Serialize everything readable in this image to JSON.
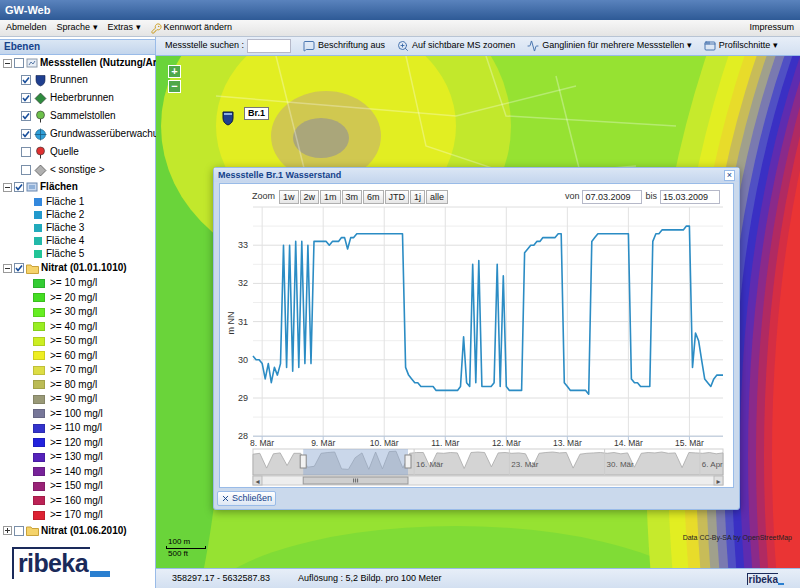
{
  "window": {
    "title": "GW-Web"
  },
  "menu": {
    "items": [
      {
        "label": "Abmelden"
      },
      {
        "label": "Sprache ▾"
      },
      {
        "label": "Extras ▾"
      },
      {
        "label": "Kennwort ändern"
      }
    ],
    "right": "Impressum"
  },
  "sidebar": {
    "title": "Ebenen",
    "groups": [
      {
        "label": "Messstellen (Nutzung/Art)",
        "kind": "stations",
        "checked": false,
        "expanded": true,
        "items": [
          {
            "label": "Brunnen",
            "checked": true,
            "color": "#1f3f8f"
          },
          {
            "label": "Heberbrunnen",
            "checked": true,
            "color": "#2e8b3e"
          },
          {
            "label": "Sammelstollen",
            "checked": true,
            "color": "#6cc04a"
          },
          {
            "label": "Grundwasserüberwachung",
            "checked": true,
            "color": "#2f9fd8"
          },
          {
            "label": "Quelle",
            "checked": false,
            "color": "#e03030"
          },
          {
            "label": "< sonstige >",
            "checked": false,
            "color": "#b0b0b0"
          }
        ]
      },
      {
        "label": "Flächen",
        "kind": "areas",
        "checked": true,
        "expanded": true,
        "items": [
          {
            "label": "Fläche 1",
            "color": "#3388dd"
          },
          {
            "label": "Fläche 2",
            "color": "#2299cc"
          },
          {
            "label": "Fläche 3",
            "color": "#22aabb"
          },
          {
            "label": "Fläche 4",
            "color": "#22b8a8"
          },
          {
            "label": "Fläche 5",
            "color": "#22c496"
          }
        ]
      },
      {
        "label": "Nitrat (01.01.1010)",
        "kind": "legend",
        "checked": true,
        "expanded": true,
        "items": [
          {
            "label": ">= 10 mg/l",
            "color": "#33cc33"
          },
          {
            "label": ">= 20 mg/l",
            "color": "#44dd22"
          },
          {
            "label": ">= 30 mg/l",
            "color": "#66ee22"
          },
          {
            "label": ">= 40 mg/l",
            "color": "#99ee22"
          },
          {
            "label": ">= 50 mg/l",
            "color": "#ccee22"
          },
          {
            "label": ">= 60 mg/l",
            "color": "#eeee22"
          },
          {
            "label": ">= 70 mg/l",
            "color": "#dddd44"
          },
          {
            "label": ">= 80 mg/l",
            "color": "#bbbb55"
          },
          {
            "label": ">= 90 mg/l",
            "color": "#999977"
          },
          {
            "label": ">= 100 mg/l",
            "color": "#777799"
          },
          {
            "label": ">= 110 mg/l",
            "color": "#3333cc"
          },
          {
            "label": ">= 120 mg/l",
            "color": "#2222dd"
          },
          {
            "label": ">= 130 mg/l",
            "color": "#5522bb"
          },
          {
            "label": ">= 140 mg/l",
            "color": "#772299"
          },
          {
            "label": ">= 150 mg/l",
            "color": "#992277"
          },
          {
            "label": ">= 160 mg/l",
            "color": "#bb2255"
          },
          {
            "label": ">= 170 mg/l",
            "color": "#dd2233"
          }
        ]
      },
      {
        "label": "Nitrat (01.06.2010)",
        "kind": "legend",
        "checked": false,
        "expanded": false,
        "items": []
      }
    ]
  },
  "logo": {
    "text": "ribeka"
  },
  "toolbar": {
    "search_label": "Messstelle suchen :",
    "search_value": "",
    "buttons": [
      "Beschriftung aus",
      "Auf sichtbare MS zoomen",
      "Ganglinien für mehrere Messstellen ▾",
      "Profilschnitte ▾"
    ]
  },
  "map": {
    "zoom_in": "+",
    "zoom_out": "−",
    "markers": [
      {
        "label": "Br.1"
      }
    ],
    "scale": {
      "metric": "100 m",
      "imperial": "500 ft"
    },
    "attribution": "Data CC-By-SA by OpenStreetMap"
  },
  "dialog": {
    "title": "Messstelle Br.1 Wasserstand",
    "close": "×",
    "zoom_label": "Zoom",
    "zoom_buttons": [
      {
        "label": "1w",
        "selected": false
      },
      {
        "label": "2w",
        "selected": false
      },
      {
        "label": "1m",
        "selected": false
      },
      {
        "label": "3m",
        "selected": false
      },
      {
        "label": "6m",
        "selected": false
      },
      {
        "label": "JTD",
        "selected": false
      },
      {
        "label": "1j",
        "selected": false
      },
      {
        "label": "alle",
        "selected": false
      }
    ],
    "from_label": "von",
    "from": "07.03.2009",
    "to_label": "bis",
    "to": "15.03.2009",
    "chart": {
      "y_axis_title": "m NN",
      "y_ticks": [
        "28",
        "29",
        "30",
        "31",
        "32",
        "33"
      ],
      "x_ticks": [
        "8. Mär",
        "9. Mär",
        "10. Mär",
        "11. Mär",
        "12. Mär",
        "13. Mär",
        "14. Mär",
        "15. Mär"
      ],
      "series": [
        {
          "values": [
            30.1,
            30.0,
            30.0,
            29.9,
            29.5,
            29.9,
            29.4,
            29.8,
            29.6,
            29.9,
            33.0,
            29.8,
            33.0,
            29.7,
            33.1,
            29.8,
            33.1,
            29.9,
            33.0,
            29.9,
            33.1,
            33.1,
            33.1,
            33.1,
            33.1,
            33.0,
            33.1,
            33.1,
            33.1,
            33.2,
            33.2,
            32.9,
            33.2,
            33.2,
            33.3,
            33.3,
            33.3,
            33.3,
            33.3,
            33.3,
            33.3,
            33.3,
            33.3,
            33.3,
            33.3,
            33.3,
            33.3,
            33.3,
            33.3,
            33.3,
            29.8,
            29.6,
            29.5,
            29.4,
            29.4,
            29.3,
            29.3,
            29.3,
            29.3,
            29.3,
            29.2,
            29.2,
            29.2,
            29.2,
            29.2,
            29.2,
            29.2,
            29.2,
            29.3,
            30.6,
            29.4,
            29.3,
            32.5,
            29.4,
            32.6,
            29.3,
            29.3,
            29.3,
            29.3,
            29.4,
            32.5,
            29.3,
            32.2,
            29.3,
            29.2,
            29.2,
            29.2,
            29.2,
            29.2,
            32.8,
            32.9,
            33.0,
            33.0,
            33.1,
            33.1,
            33.2,
            33.2,
            33.2,
            33.2,
            33.2,
            33.3,
            33.3,
            29.4,
            29.3,
            29.2,
            29.2,
            29.2,
            29.2,
            29.2,
            29.2,
            29.1,
            33.1,
            33.2,
            33.3,
            33.3,
            33.3,
            33.3,
            33.3,
            33.3,
            33.3,
            33.3,
            33.3,
            33.3,
            33.3,
            29.5,
            29.4,
            29.4,
            29.3,
            29.3,
            29.3,
            29.3,
            33.1,
            33.3,
            33.3,
            33.4,
            33.4,
            33.4,
            33.4,
            33.4,
            33.4,
            33.4,
            33.4,
            33.5,
            33.5,
            29.8,
            30.7,
            30.5,
            30.0,
            29.5,
            29.4,
            29.3,
            29.5,
            29.6,
            29.6,
            29.6
          ]
        }
      ],
      "navigator": {
        "x_ticks": [
          "16. Mär",
          "23. Mär",
          "30. Mär",
          "6. Apr"
        ],
        "values": [
          32.8,
          33.0,
          29.6,
          32.9,
          33.1,
          30.2,
          33.0,
          33.0,
          29.8,
          30.0,
          33.0,
          33.2,
          33.3,
          29.4,
          29.3,
          32.0,
          33.1,
          29.3,
          33.3,
          29.4,
          33.4,
          33.5,
          29.6,
          33.0,
          33.2,
          33.2,
          29.8,
          33.1,
          33.0,
          33.2,
          33.1,
          29.5,
          33.2,
          33.3,
          33.2,
          29.9,
          33.1,
          33.2,
          33.0,
          33.1,
          32.9,
          29.7,
          33.0,
          33.2,
          33.3,
          33.1,
          33.2,
          29.6,
          32.8,
          33.0,
          33.1,
          33.2,
          33.0,
          33.2,
          32.9,
          33.1,
          29.8,
          33.0,
          33.2,
          33.1,
          33.3,
          33.0,
          33.1,
          29.7,
          33.2,
          33.1,
          33.0,
          33.2,
          32.9,
          33.1
        ]
      }
    },
    "scroll_left": "◂",
    "scroll_right": "▸",
    "close_button": "Schließen"
  },
  "status_bar": {
    "coordinates": "358297.17 - 5632587.83",
    "resolution": "Auflösung : 5,2 Bildp. pro 100 Meter",
    "logo": "ribeka"
  }
}
